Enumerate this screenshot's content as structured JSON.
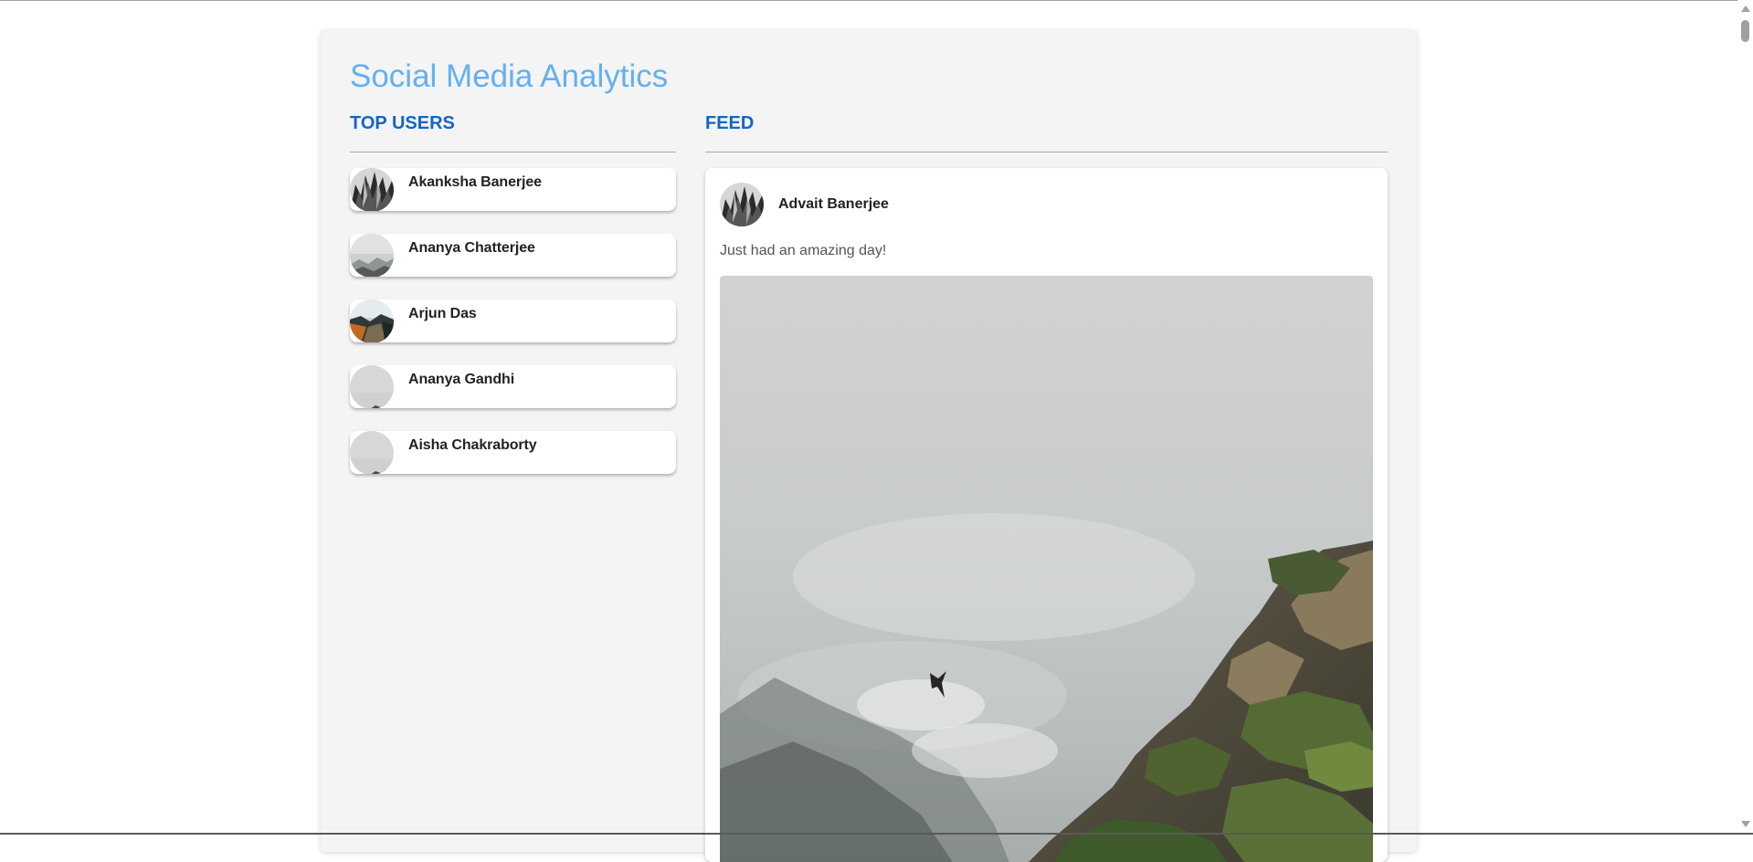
{
  "app": {
    "title": "Social Media Analytics"
  },
  "top_users": {
    "heading": "TOP USERS",
    "users": [
      {
        "name": "Akanksha Banerjee",
        "avatar": "abstract-bw-avatar"
      },
      {
        "name": "Ananya Chatterjee",
        "avatar": "misty-mountain-avatar"
      },
      {
        "name": "Arjun Das",
        "avatar": "landscape-sunset-avatar"
      },
      {
        "name": "Ananya Gandhi",
        "avatar": "foggy-cliff-avatar"
      },
      {
        "name": "Aisha Chakraborty",
        "avatar": "foggy-cliff-avatar"
      }
    ]
  },
  "feed": {
    "heading": "FEED",
    "posts": [
      {
        "author": "Advait Banerjee",
        "avatar": "abstract-bw-avatar",
        "text": "Just had an amazing day!",
        "image": "foggy-coastal-cliff-with-bird"
      }
    ]
  },
  "colors": {
    "title": "#64b0f0",
    "heading": "#1565c0",
    "panel_background": "#f4f4f4",
    "card_background": "#ffffff"
  }
}
